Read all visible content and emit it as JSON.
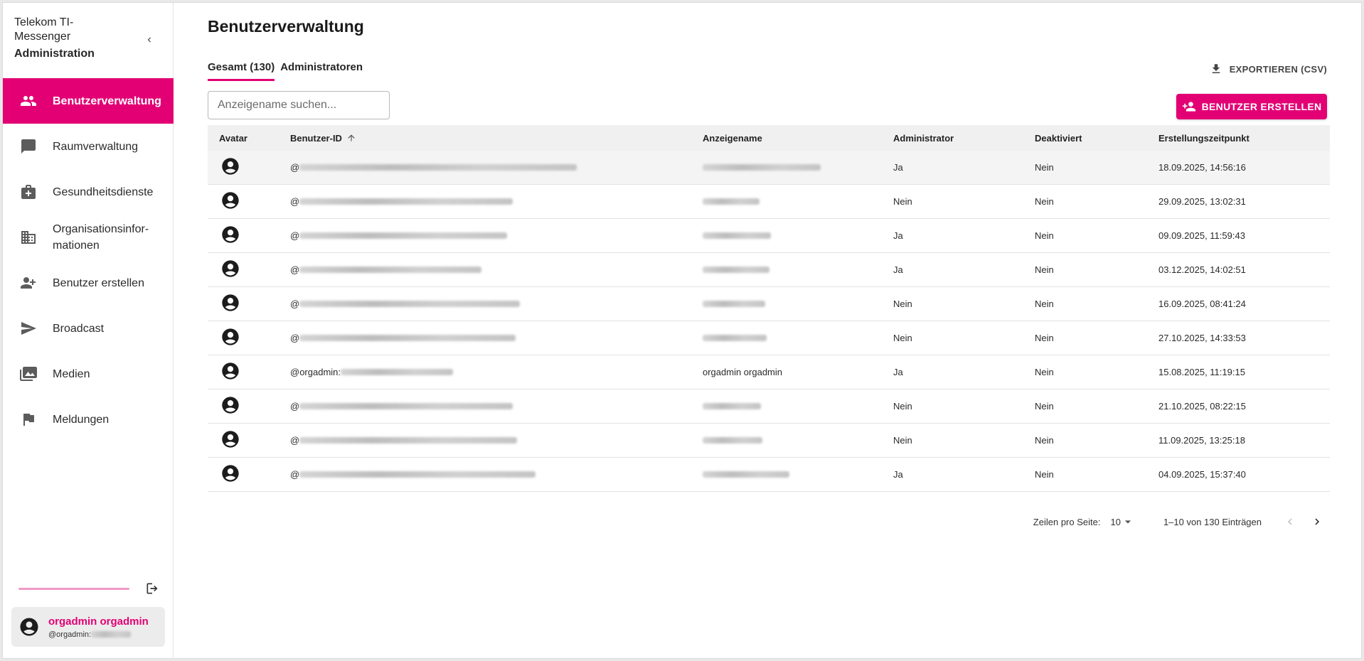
{
  "sidebar": {
    "brand_line1": "Telekom TI-",
    "brand_line2": "Messenger",
    "brand_line3": "Administration",
    "items": [
      {
        "label": "Benutzerverwaltung",
        "icon": "users-icon",
        "active": true
      },
      {
        "label": "Raumverwaltung",
        "icon": "chat-icon"
      },
      {
        "label": "Gesundheitsdienste",
        "icon": "medical-bag-icon"
      },
      {
        "label": "Organisationsinfor-",
        "label2": "mationen",
        "icon": "building-icon"
      },
      {
        "label": "Benutzer erstellen",
        "icon": "add-user-icon"
      },
      {
        "label": "Broadcast",
        "icon": "send-icon"
      },
      {
        "label": "Medien",
        "icon": "media-icon"
      },
      {
        "label": "Meldungen",
        "icon": "flag-icon"
      }
    ],
    "user": {
      "name": "orgadmin orgadmin",
      "id_prefix": "@orgadmin:"
    }
  },
  "main": {
    "title": "Benutzerverwaltung",
    "tabs": [
      {
        "label": "Gesamt (130)",
        "active": true
      },
      {
        "label": "Administratoren"
      }
    ],
    "export_label": "EXPORTIEREN (CSV)",
    "search_placeholder": "Anzeigename suchen...",
    "create_label": "BENUTZER ERSTELLEN"
  },
  "table": {
    "headers": {
      "avatar": "Avatar",
      "user_id": "Benutzer-ID",
      "display_name": "Anzeigename",
      "admin": "Administrator",
      "deactivated": "Deaktiviert",
      "created": "Erstellungszeitpunkt"
    },
    "rows": [
      {
        "id_prefix": "@",
        "name": "",
        "admin": "Ja",
        "deactivated": "Nein",
        "created": "18.09.2025, 14:56:16"
      },
      {
        "id_prefix": "@",
        "name": "",
        "admin": "Nein",
        "deactivated": "Nein",
        "created": "29.09.2025, 13:02:31"
      },
      {
        "id_prefix": "@",
        "name": "",
        "admin": "Ja",
        "deactivated": "Nein",
        "created": "09.09.2025, 11:59:43"
      },
      {
        "id_prefix": "@",
        "name": "",
        "admin": "Ja",
        "deactivated": "Nein",
        "created": "03.12.2025, 14:02:51"
      },
      {
        "id_prefix": "@",
        "name": "",
        "admin": "Nein",
        "deactivated": "Nein",
        "created": "16.09.2025, 08:41:24"
      },
      {
        "id_prefix": "@",
        "name": "",
        "admin": "Nein",
        "deactivated": "Nein",
        "created": "27.10.2025, 14:33:53"
      },
      {
        "id_prefix": "@orgadmin:",
        "name": "orgadmin orgadmin",
        "admin": "Ja",
        "deactivated": "Nein",
        "created": "15.08.2025, 11:19:15"
      },
      {
        "id_prefix": "@",
        "name": "",
        "admin": "Nein",
        "deactivated": "Nein",
        "created": "21.10.2025, 08:22:15"
      },
      {
        "id_prefix": "@",
        "name": "",
        "admin": "Nein",
        "deactivated": "Nein",
        "created": "11.09.2025, 13:25:18"
      },
      {
        "id_prefix": "@",
        "name": "",
        "admin": "Ja",
        "deactivated": "Nein",
        "created": "04.09.2025, 15:37:40"
      }
    ]
  },
  "pagination": {
    "rows_per_page_label": "Zeilen pro Seite:",
    "rows_per_page": "10",
    "range": "1–10 von 130 Einträgen"
  },
  "colors": {
    "accent": "#e20074"
  }
}
